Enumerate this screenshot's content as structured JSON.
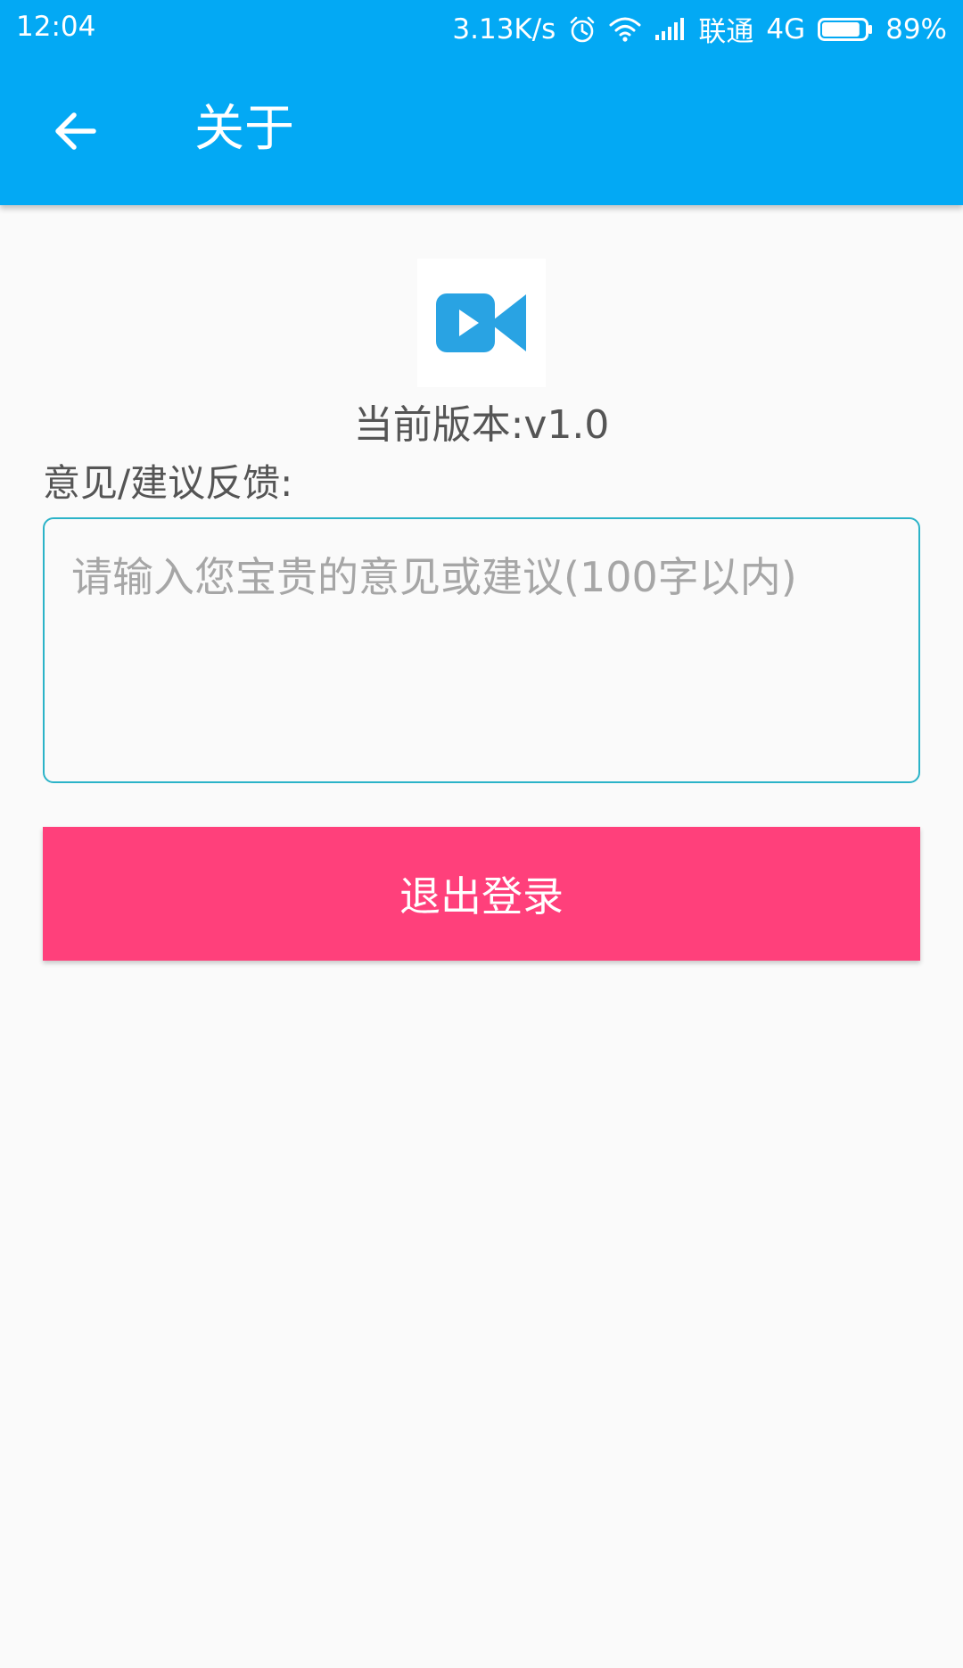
{
  "status_bar": {
    "time": "12:04",
    "network_speed": "3.13K/s",
    "carrier": "联通",
    "network_type": "4G",
    "battery": "89%",
    "battery_level": 0.89,
    "icons": [
      "alarm-icon",
      "wifi-icon",
      "signal-icon",
      "battery-icon"
    ]
  },
  "toolbar": {
    "title": "关于",
    "back_icon": "arrow-back-icon"
  },
  "about": {
    "logo_icon": "video-camera-icon",
    "version_text": "当前版本:v1.0",
    "feedback_label": "意见/建议反馈:",
    "feedback_value": "",
    "feedback_placeholder": "请输入您宝贵的意见或建议(100字以内)",
    "logout_label": "退出登录"
  },
  "colors": {
    "appbar": "#03a9f4",
    "accent": "#ff407b",
    "input_border": "#2bb3c8",
    "logo": "#29a3e3",
    "background": "#fafafa"
  }
}
